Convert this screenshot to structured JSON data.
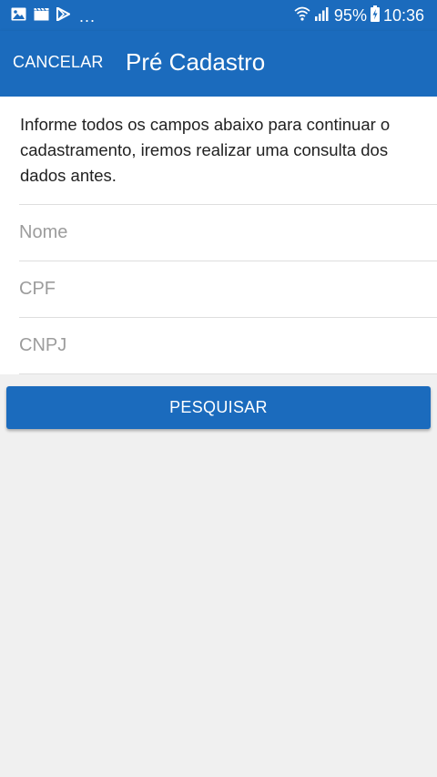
{
  "status_bar": {
    "battery_percent": "95%",
    "time": "10:36",
    "overflow_dots": "...",
    "icons": [
      "image-icon",
      "clapperboard-icon",
      "play-store-icon",
      "wifi-icon",
      "signal-icon",
      "battery-charging-icon"
    ]
  },
  "toolbar": {
    "cancel_label": "CANCELAR",
    "title": "Pré Cadastro"
  },
  "form": {
    "intro": "Informe todos os campos abaixo para continuar o cadastramento, iremos realizar uma consulta dos dados antes.",
    "name_placeholder": "Nome",
    "cpf_placeholder": "CPF",
    "cnpj_placeholder": "CNPJ",
    "name_value": "",
    "cpf_value": "",
    "cnpj_value": ""
  },
  "actions": {
    "search_label": "PESQUISAR"
  },
  "colors": {
    "primary": "#1b6bbd",
    "background": "#f0f0f0",
    "surface": "#ffffff",
    "placeholder": "#9c9c9c"
  }
}
